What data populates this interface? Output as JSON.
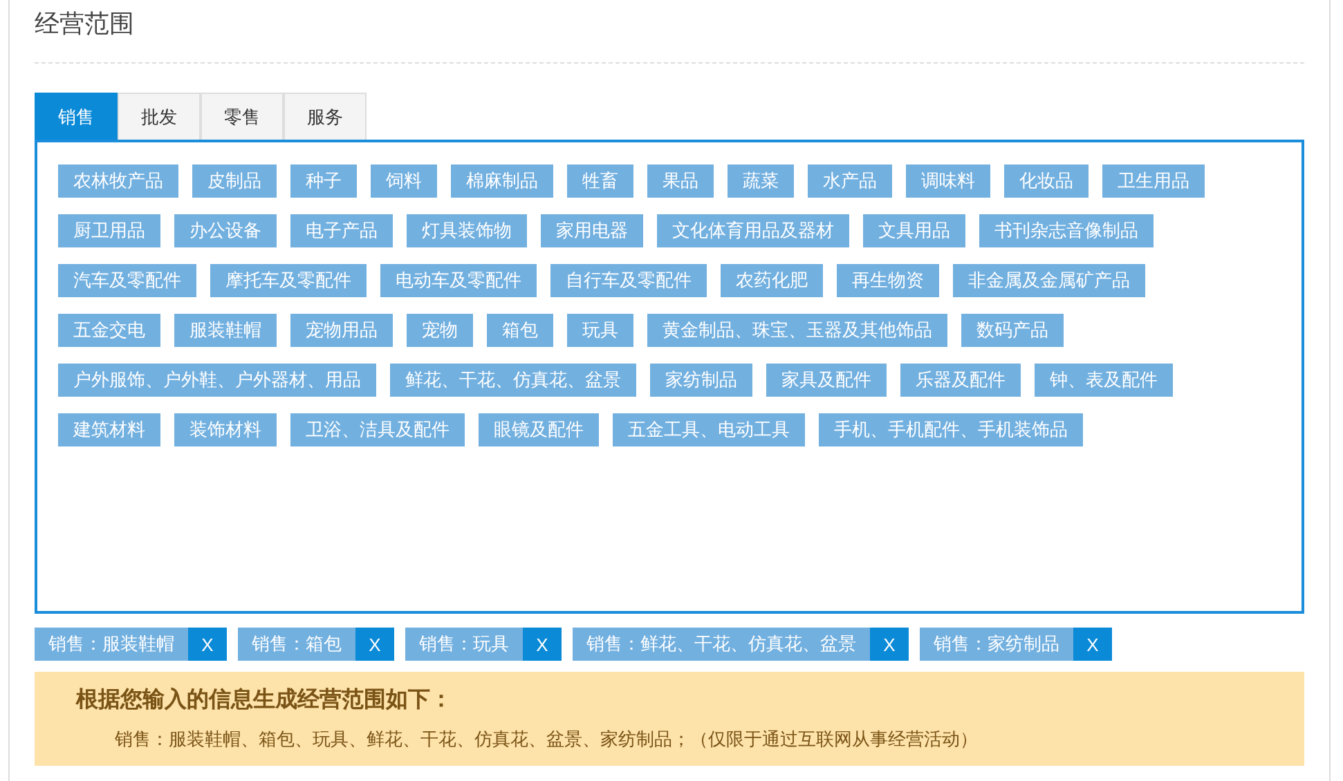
{
  "title": "经营范围",
  "tabs": [
    {
      "label": "销售",
      "selected": true
    },
    {
      "label": "批发",
      "selected": false
    },
    {
      "label": "零售",
      "selected": false
    },
    {
      "label": "服务",
      "selected": false
    }
  ],
  "tag_rows": [
    [
      "农林牧产品",
      "皮制品",
      "种子",
      "饲料",
      "棉麻制品",
      "牲畜",
      "果品",
      "蔬菜",
      "水产品",
      "调味料",
      "化妆品",
      "卫生用品"
    ],
    [
      "厨卫用品",
      "办公设备",
      "电子产品",
      "灯具装饰物",
      "家用电器",
      "文化体育用品及器材",
      "文具用品",
      "书刊杂志音像制品"
    ],
    [
      "汽车及零配件",
      "摩托车及零配件",
      "电动车及零配件",
      "自行车及零配件",
      "农药化肥",
      "再生物资",
      "非金属及金属矿产品"
    ],
    [
      "五金交电",
      "服装鞋帽",
      "宠物用品",
      "宠物",
      "箱包",
      "玩具",
      "黄金制品、珠宝、玉器及其他饰品",
      "数码产品"
    ],
    [
      "户外服饰、户外鞋、户外器材、用品",
      "鲜花、干花、仿真花、盆景",
      "家纺制品",
      "家具及配件",
      "乐器及配件",
      "钟、表及配件"
    ],
    [
      "建筑材料",
      "装饰材料",
      "卫浴、洁具及配件",
      "眼镜及配件",
      "五金工具、电动工具",
      "手机、手机配件、手机装饰品"
    ]
  ],
  "chosen": [
    {
      "label": "销售：服装鞋帽",
      "remove": "X"
    },
    {
      "label": "销售：箱包",
      "remove": "X"
    },
    {
      "label": "销售：玩具",
      "remove": "X"
    },
    {
      "label": "销售：鲜花、干花、仿真花、盆景",
      "remove": "X"
    },
    {
      "label": "销售：家纺制品",
      "remove": "X"
    }
  ],
  "result": {
    "heading": "根据您输入的信息生成经营范围如下：",
    "text": "销售：服装鞋帽、箱包、玩具、鲜花、干花、仿真花、盆景、家纺制品；（仅限于通过互联网从事经营活动）"
  }
}
